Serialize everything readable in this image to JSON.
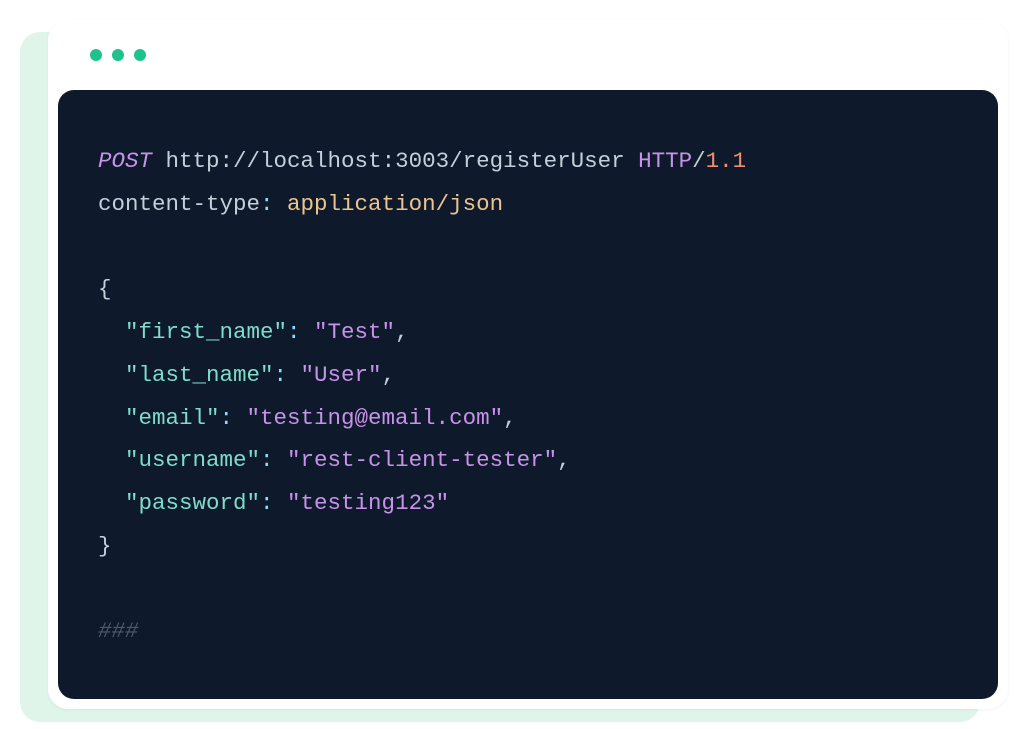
{
  "request": {
    "method": "POST",
    "url": "http://localhost:3003/registerUser",
    "protocol": "HTTP",
    "version": "1.1",
    "header_key": "content-type",
    "header_value": "application/json",
    "body": {
      "open_brace": "{",
      "close_brace": "}",
      "fields": {
        "first_name_key": "\"first_name\"",
        "first_name_val": "\"Test\"",
        "last_name_key": "\"last_name\"",
        "last_name_val": "\"User\"",
        "email_key": "\"email\"",
        "email_val": "\"testing@email.com\"",
        "username_key": "\"username\"",
        "username_val": "\"rest-client-tester\"",
        "password_key": "\"password\"",
        "password_val": "\"testing123\""
      }
    },
    "separator": "###"
  },
  "punct": {
    "colon": ":",
    "colon_sp": ": ",
    "comma": ",",
    "slash": "/"
  }
}
